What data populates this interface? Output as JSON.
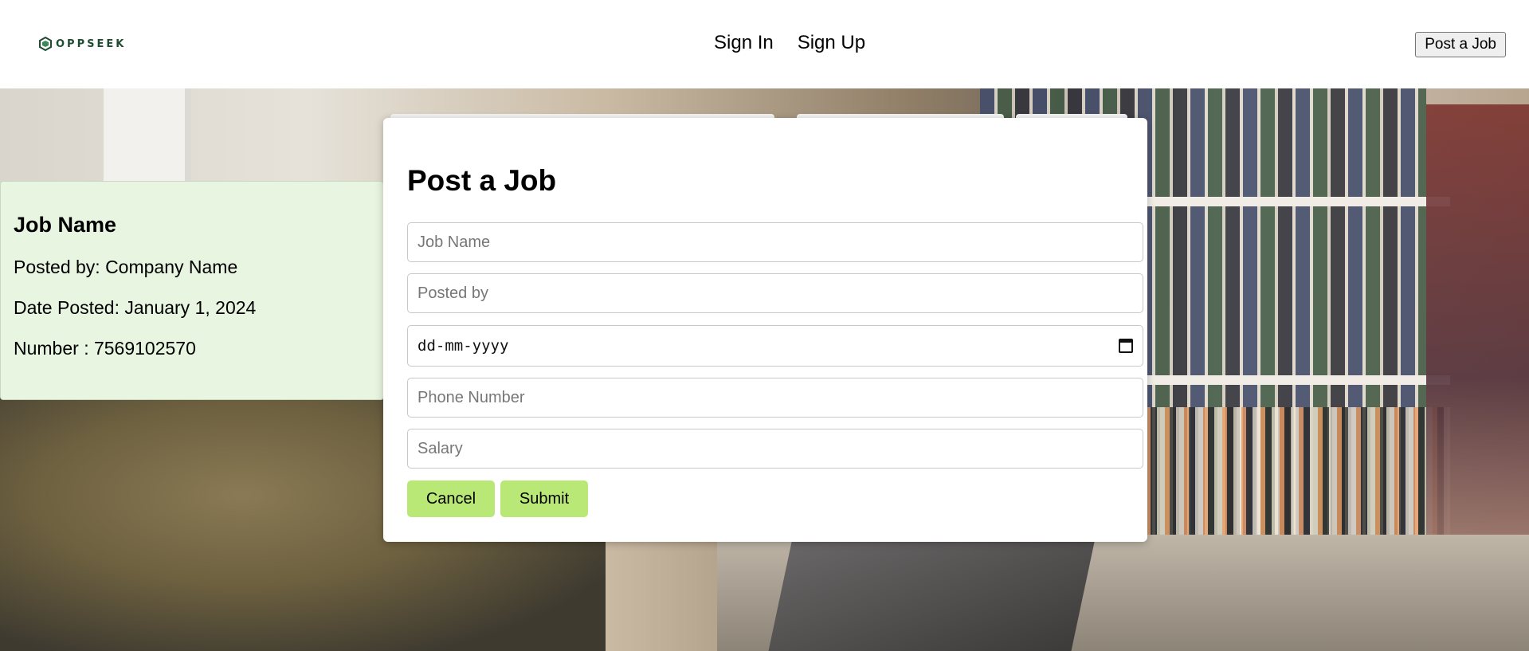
{
  "header": {
    "logo_text": "OPPSEEK",
    "nav": [
      {
        "label": "Sign In"
      },
      {
        "label": "Sign Up"
      }
    ],
    "post_job_button": "Post a Job"
  },
  "job_card": {
    "title": "Job Name",
    "posted_by": "Posted by: Company Name",
    "date_posted": "Date Posted: January 1, 2024",
    "number": "Number : 7569102570"
  },
  "modal": {
    "title": "Post a Job",
    "fields": {
      "job_name_placeholder": "Job Name",
      "posted_by_placeholder": "Posted by",
      "date_placeholder": "dd-mm-yyyy",
      "phone_placeholder": "Phone Number",
      "salary_placeholder": "Salary"
    },
    "cancel_label": "Cancel",
    "submit_label": "Submit"
  },
  "colors": {
    "accent_button": "#b9e877",
    "card_background": "#e8f5e0",
    "logo": "#1f4d33"
  },
  "icons": {
    "logo": "hexagon-logo-icon",
    "date": "calendar-icon"
  }
}
